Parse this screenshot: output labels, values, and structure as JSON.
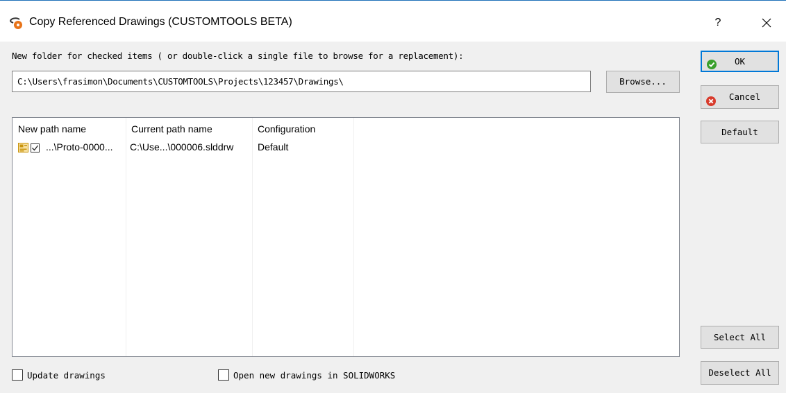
{
  "window": {
    "title": "Copy Referenced Drawings (CUSTOMTOOLS BETA)",
    "help_label": "?"
  },
  "prompt": {
    "label": "New folder for checked items ( or double-click a single file to browse for a replacement):"
  },
  "path_input": {
    "value": "C:\\Users\\frasimon\\Documents\\CUSTOMTOOLS\\Projects\\123457\\Drawings\\"
  },
  "buttons": {
    "ok": "OK",
    "cancel": "Cancel",
    "browse": "Browse...",
    "default": "Default",
    "select_all": "Select All",
    "deselect_all": "Deselect All"
  },
  "table": {
    "columns": [
      "New path name",
      "Current path name",
      "Configuration"
    ],
    "rows": [
      {
        "checked": true,
        "new_path": "...\\Proto-0000...",
        "current_path": "C:\\Use...\\000006.slddrw",
        "configuration": "Default"
      }
    ]
  },
  "options": {
    "update_drawings": {
      "label": "Update drawings",
      "checked": false
    },
    "open_new_drawings": {
      "label": "Open new drawings in SOLIDWORKS",
      "checked": false
    }
  },
  "colors": {
    "ok_icon": "#3aa02c",
    "cancel_icon": "#d83b2c",
    "focus_border": "#0078d7"
  },
  "icons": {
    "app": "customtools-app-icon",
    "ok": "check-circle-icon",
    "cancel": "x-circle-icon",
    "close": "close-icon",
    "row": "drawing-file-icon"
  }
}
